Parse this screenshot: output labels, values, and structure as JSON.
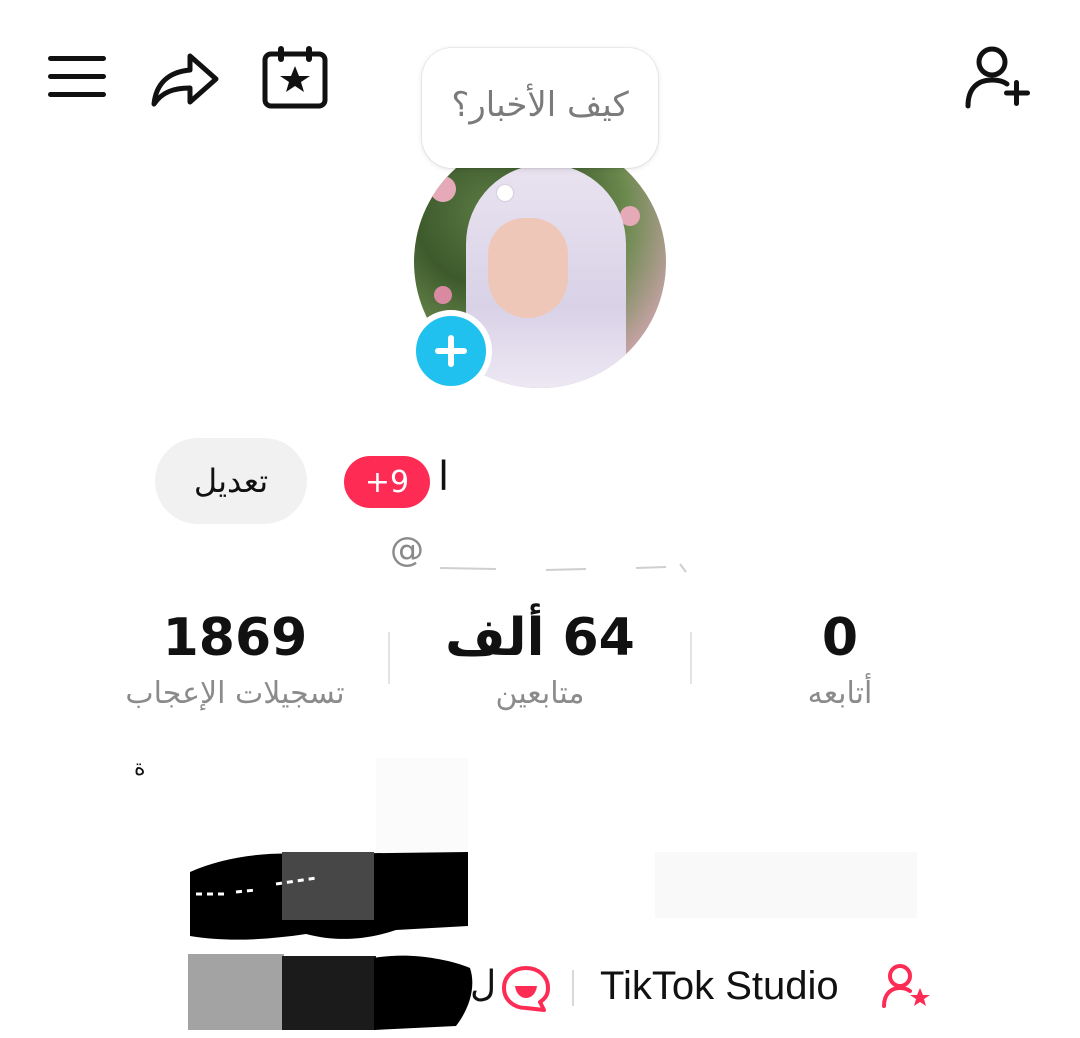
{
  "header": {
    "menu_icon": "hamburger-menu-icon",
    "share_icon": "share-arrow-icon",
    "calendar_icon": "calendar-star-icon",
    "add_friend_icon": "add-user-icon"
  },
  "story_bubble": {
    "text": "كيف الأخبار؟"
  },
  "profile": {
    "edit_label": "تعديل",
    "notification_badge": "+9",
    "name_fragment": "ا",
    "handle_prefix": "@"
  },
  "stats": {
    "likes": {
      "value": "1869",
      "label": "تسجيلات الإعجاب"
    },
    "followers": {
      "value": "64 ألف",
      "label": "متابعين"
    },
    "following": {
      "value": "0",
      "label": "أتابعه"
    }
  },
  "links": {
    "studio_label": "TikTok Studio",
    "truncated_text": "ل",
    "stray_mark": "ة"
  },
  "colors": {
    "accent_pink": "#fe2c55",
    "add_story_blue": "#20c1ef",
    "secondary_text": "#8b8b8b"
  }
}
